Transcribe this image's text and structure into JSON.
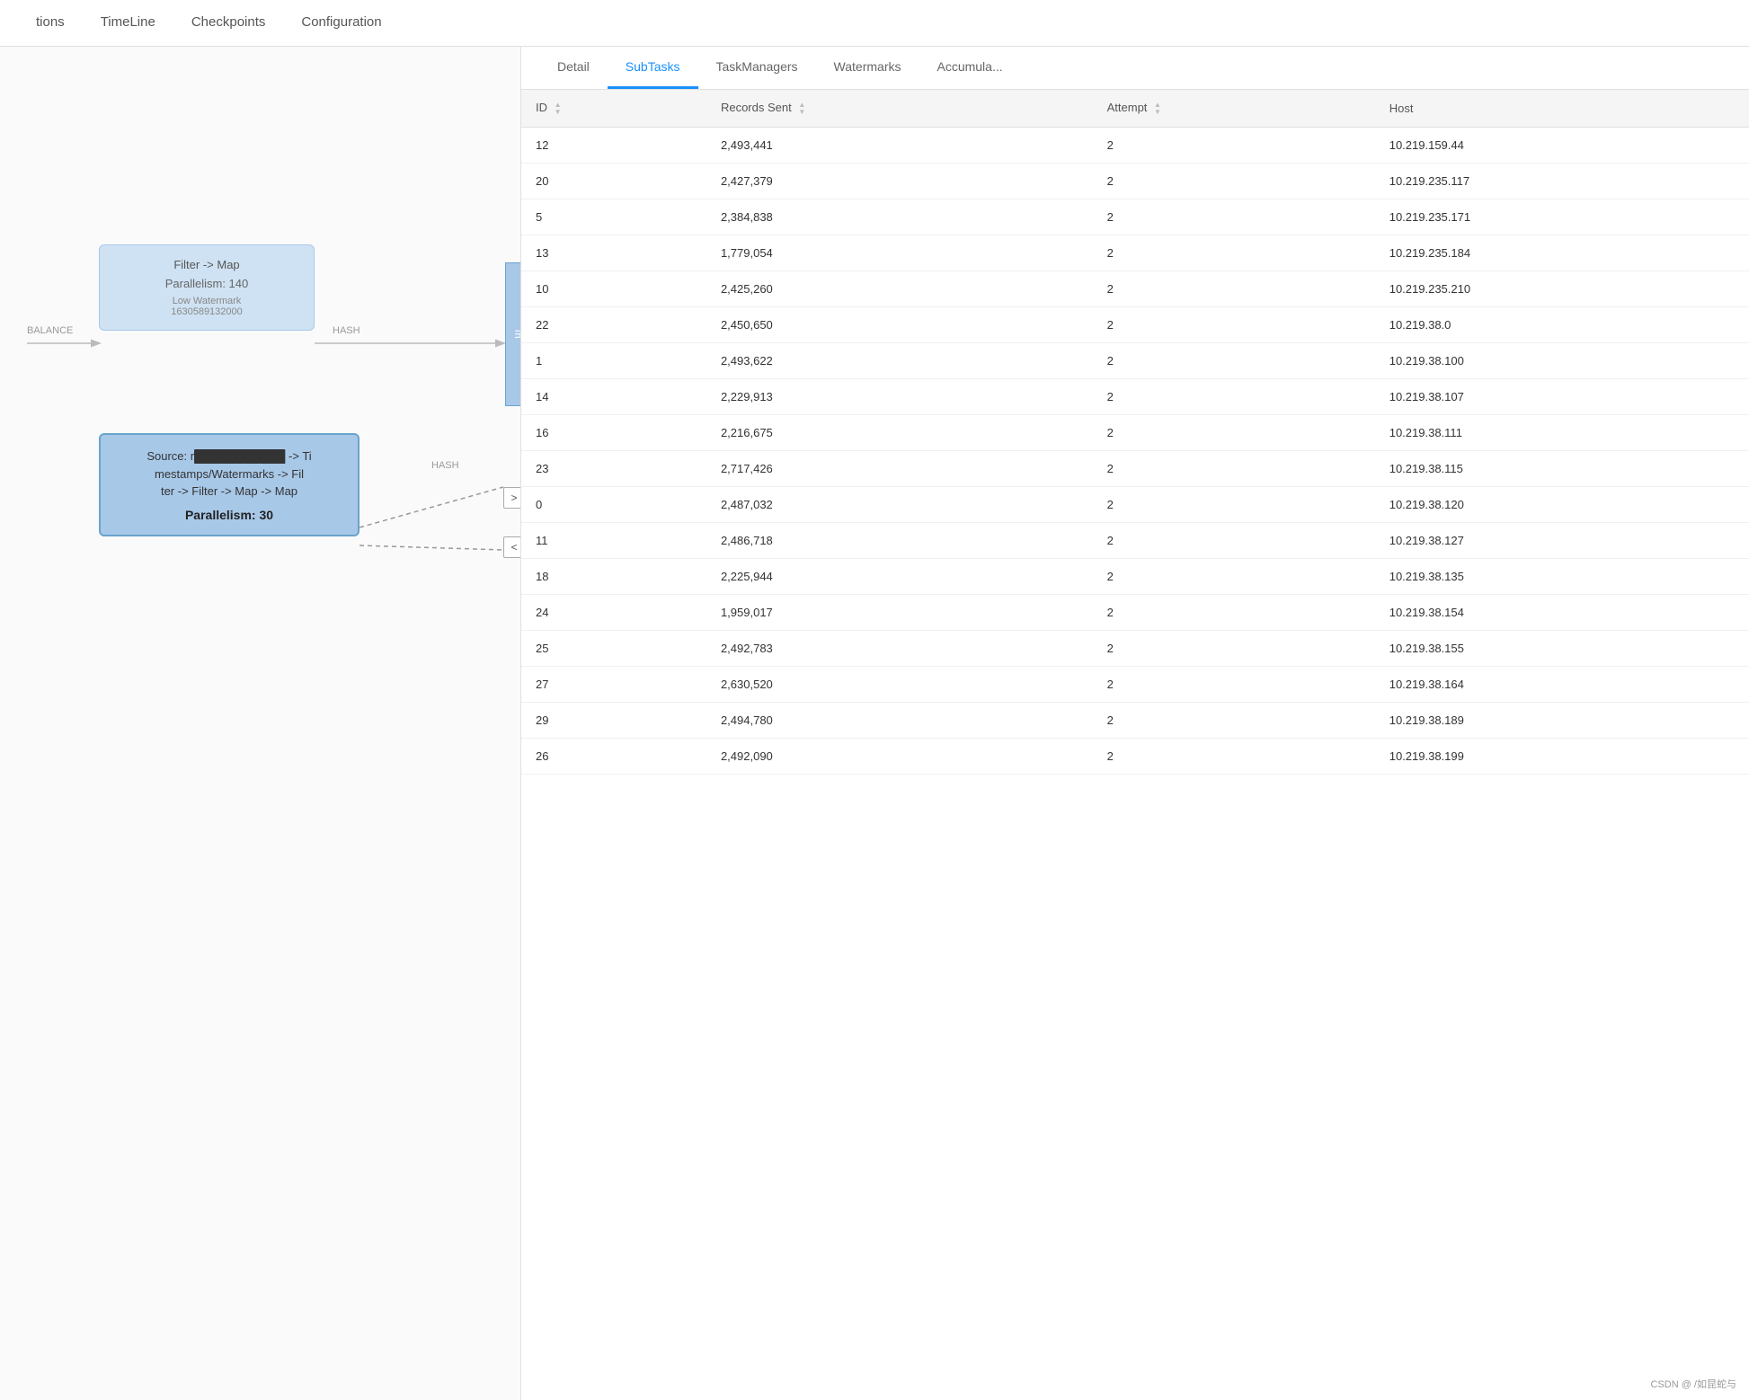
{
  "nav": {
    "items": [
      {
        "label": "tions",
        "active": false
      },
      {
        "label": "TimeLine",
        "active": false
      },
      {
        "label": "Checkpoints",
        "active": false
      },
      {
        "label": "Configuration",
        "active": false
      }
    ]
  },
  "graph": {
    "node_filter_map": {
      "title": "Filter -> Map",
      "parallelism": "Parallelism: 140",
      "watermark_label": "Low Watermark",
      "watermark_value": "1630589132000"
    },
    "node_source": {
      "title": "Source: r██████████ -> Timestamps/Watermarks -> Filter -> Filter -> Map -> Map",
      "parallelism": "Parallelism: 30"
    },
    "label_balance": "BALANCE",
    "label_hash_1": "HASH",
    "label_hash_2": "HASH"
  },
  "tabs": {
    "items": [
      {
        "label": "Detail",
        "active": false
      },
      {
        "label": "SubTasks",
        "active": true
      },
      {
        "label": "TaskManagers",
        "active": false
      },
      {
        "label": "Watermarks",
        "active": false
      },
      {
        "label": "Accumula...",
        "active": false
      }
    ]
  },
  "table": {
    "columns": [
      {
        "label": "ID",
        "sortable": true
      },
      {
        "label": "Records Sent",
        "sortable": true
      },
      {
        "label": "Attempt",
        "sortable": true
      },
      {
        "label": "Host",
        "sortable": false
      }
    ],
    "rows": [
      {
        "id": "12",
        "records_sent": "2,493,441",
        "attempt": "2",
        "host": "10.219.159.44"
      },
      {
        "id": "20",
        "records_sent": "2,427,379",
        "attempt": "2",
        "host": "10.219.235.117"
      },
      {
        "id": "5",
        "records_sent": "2,384,838",
        "attempt": "2",
        "host": "10.219.235.171"
      },
      {
        "id": "13",
        "records_sent": "1,779,054",
        "attempt": "2",
        "host": "10.219.235.184"
      },
      {
        "id": "10",
        "records_sent": "2,425,260",
        "attempt": "2",
        "host": "10.219.235.210"
      },
      {
        "id": "22",
        "records_sent": "2,450,650",
        "attempt": "2",
        "host": "10.219.38.0"
      },
      {
        "id": "1",
        "records_sent": "2,493,622",
        "attempt": "2",
        "host": "10.219.38.100"
      },
      {
        "id": "14",
        "records_sent": "2,229,913",
        "attempt": "2",
        "host": "10.219.38.107"
      },
      {
        "id": "16",
        "records_sent": "2,216,675",
        "attempt": "2",
        "host": "10.219.38.111"
      },
      {
        "id": "23",
        "records_sent": "2,717,426",
        "attempt": "2",
        "host": "10.219.38.115"
      },
      {
        "id": "0",
        "records_sent": "2,487,032",
        "attempt": "2",
        "host": "10.219.38.120"
      },
      {
        "id": "11",
        "records_sent": "2,486,718",
        "attempt": "2",
        "host": "10.219.38.127"
      },
      {
        "id": "18",
        "records_sent": "2,225,944",
        "attempt": "2",
        "host": "10.219.38.135"
      },
      {
        "id": "24",
        "records_sent": "1,959,017",
        "attempt": "2",
        "host": "10.219.38.154"
      },
      {
        "id": "25",
        "records_sent": "2,492,783",
        "attempt": "2",
        "host": "10.219.38.155"
      },
      {
        "id": "27",
        "records_sent": "2,630,520",
        "attempt": "2",
        "host": "10.219.38.164"
      },
      {
        "id": "29",
        "records_sent": "2,494,780",
        "attempt": "2",
        "host": "10.219.38.189"
      },
      {
        "id": "26",
        "records_sent": "2,492,090",
        "attempt": "2",
        "host": "10.219.38.199"
      }
    ]
  },
  "watermark_logo": "CSDN @ /如昆蛇与"
}
